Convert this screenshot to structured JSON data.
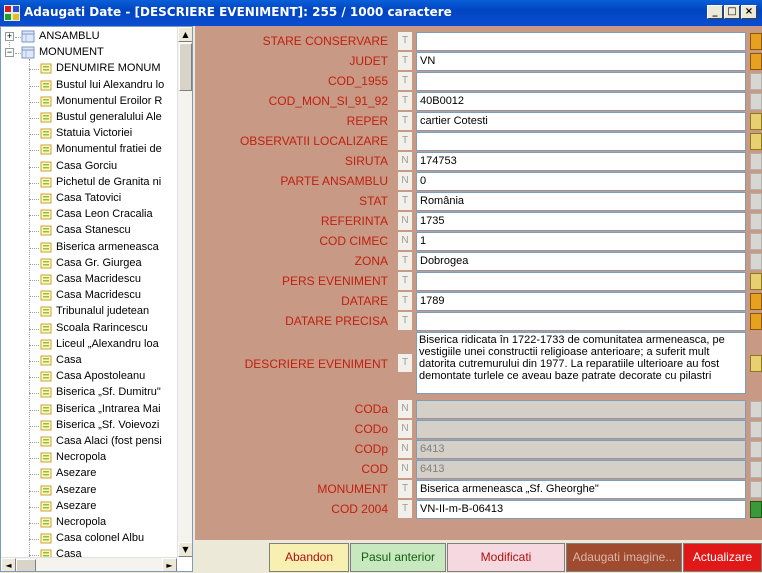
{
  "window": {
    "title": "Adaugati Date - [DESCRIERE EVENIMENT]: 255 / 1000 caractere",
    "minimize_label": "_",
    "maximize_label": "□",
    "close_label": "×"
  },
  "tree": {
    "root_items": [
      {
        "label": "ANSAMBLU",
        "expander": "+"
      },
      {
        "label": "MONUMENT",
        "expander": "−"
      }
    ],
    "children": [
      "DENUMIRE MONUM",
      "Bustul lui Alexandru lo",
      "Monumentul Eroilor R",
      "Bustul generalului Ale",
      "Statuia Victoriei",
      "Monumentul fratiei de",
      "Casa Gorciu",
      "Pichetul de Granita ni",
      "Casa Tatovici",
      "Casa Leon Cracalia",
      "Casa Stanescu",
      "Biserica armeneasca",
      "Casa Gr. Giurgea",
      "Casa Macridescu",
      "Casa Macridescu",
      "Tribunalul judetean",
      "Scoala Rarincescu",
      "Liceul „Alexandru loa",
      "Casa",
      "Casa Apostoleanu",
      "Biserica „Sf. Dumitru\"",
      "Biserica „Intrarea Mai",
      "Biserica „Sf. Voievozi",
      "Casa Alaci (fost pensi",
      "Necropola",
      "Asezare",
      "Asezare",
      "Asezare",
      "Necropola",
      "Casa colonel Albu",
      "Casa"
    ],
    "scroll_up": "▲",
    "scroll_down": "▼",
    "scroll_left": "◄",
    "scroll_right": "►"
  },
  "fields": [
    {
      "label": "STARE CONSERVARE",
      "type": "T",
      "value": "",
      "btn": "gold"
    },
    {
      "label": "JUDET",
      "type": "T",
      "value": "VN",
      "btn": "gold"
    },
    {
      "label": "COD_1955",
      "type": "T",
      "value": "",
      "btn": "plain"
    },
    {
      "label": "COD_MON_SI_91_92",
      "type": "T",
      "value": "40B0012",
      "btn": "plain"
    },
    {
      "label": "REPER",
      "type": "T",
      "value": "cartier Cotesti",
      "btn": "folder"
    },
    {
      "label": "OBSERVATII LOCALIZARE",
      "type": "T",
      "value": "",
      "btn": "folder"
    },
    {
      "label": "SIRUTA",
      "type": "N",
      "value": "174753",
      "btn": "plain"
    },
    {
      "label": "PARTE ANSAMBLU",
      "type": "N",
      "value": "0",
      "btn": "plain"
    },
    {
      "label": "STAT",
      "type": "T",
      "value": "România",
      "btn": "plain"
    },
    {
      "label": "REFERINTA",
      "type": "N",
      "value": "1735",
      "btn": "plain"
    },
    {
      "label": "COD CIMEC",
      "type": "N",
      "value": "1",
      "btn": "plain"
    },
    {
      "label": "ZONA",
      "type": "T",
      "value": "Dobrogea",
      "btn": "plain"
    },
    {
      "label": "PERS EVENIMENT",
      "type": "T",
      "value": "",
      "btn": "folder"
    },
    {
      "label": "DATARE",
      "type": "T",
      "value": "1789",
      "btn": "gold"
    },
    {
      "label": "DATARE PRECISA",
      "type": "T",
      "value": "",
      "btn": "gold"
    }
  ],
  "description": {
    "label": "DESCRIERE EVENIMENT",
    "type": "T",
    "value": "Biserica ridicata în 1722-1733 de comunitatea armeneasca, pe vestigiile unei constructii religioase anterioare; a suferit mult datorita cutremurului din 1977. La reparatiile ulterioare au fost demontate turlele ce aveau baze patrate decorate cu pilastri"
  },
  "fields_bottom": [
    {
      "label": "CODa",
      "type": "N",
      "value": "",
      "disabled": true,
      "btn": "plain"
    },
    {
      "label": "CODo",
      "type": "N",
      "value": "",
      "disabled": true,
      "btn": "plain"
    },
    {
      "label": "CODp",
      "type": "N",
      "value": "6413",
      "disabled": true,
      "btn": "plain"
    },
    {
      "label": "COD",
      "type": "N",
      "value": "6413",
      "disabled": true,
      "btn": "plain"
    },
    {
      "label": "MONUMENT",
      "type": "T",
      "value": "Biserica armeneasca „Sf. Gheorghe\"",
      "disabled": false,
      "btn": "plain"
    },
    {
      "label": "COD 2004",
      "type": "T",
      "value": "VN-II-m-B-06413",
      "disabled": false,
      "btn": "green"
    }
  ],
  "actions": {
    "abandon": "Abandon",
    "previous": "Pasul anterior",
    "modified": "Modificati",
    "add_images": "Adaugati imagine...",
    "update": "Actualizare"
  },
  "colors": {
    "form_bg": "#c89a86",
    "label_red": "#c02010",
    "abandon_bg": "#f7f0b0",
    "abandon_fg": "#b01010",
    "previous_bg": "#c8e8c0",
    "previous_fg": "#106010",
    "modified_bg": "#f5d8e0",
    "modified_fg": "#b01010",
    "add_images_bg": "#a04a30",
    "add_images_fg": "#d8b8a8",
    "update_bg": "#e01818",
    "update_fg": "#ffffff"
  }
}
